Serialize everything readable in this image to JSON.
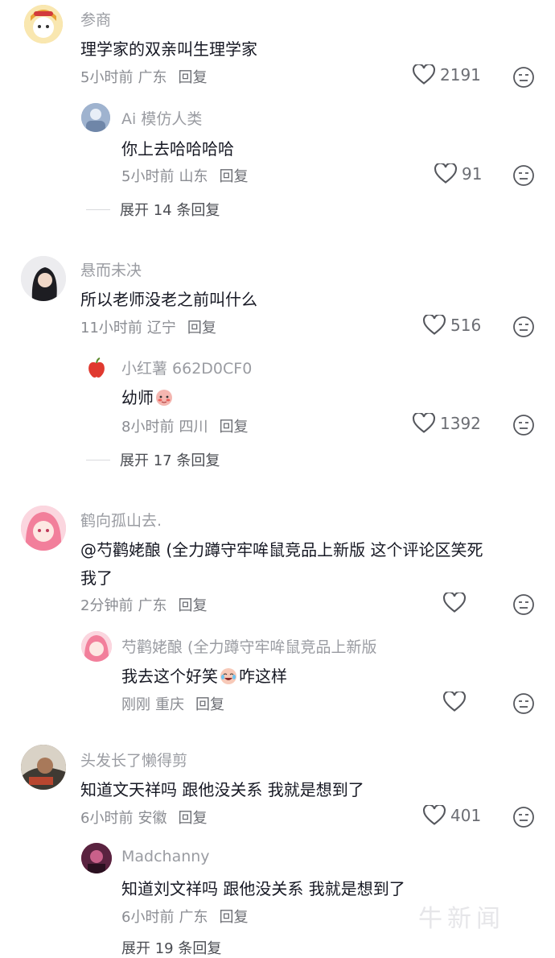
{
  "comments": [
    {
      "name": "参商",
      "text": "理学家的双亲叫生理学家",
      "time": "5小时前",
      "location": "广东",
      "reply_label": "回复",
      "likes": "2191",
      "avatar_color": "#f2b24a",
      "replies": [
        {
          "name": "Ai 模仿人类",
          "text": "你上去哈哈哈哈",
          "time": "5小时前",
          "location": "山东",
          "reply_label": "回复",
          "likes": "91",
          "avatar_color": "#8aa0c2"
        }
      ],
      "expand": "展开 14 条回复"
    },
    {
      "name": "悬而未决",
      "text": "所以老师没老之前叫什么",
      "time": "11小时前",
      "location": "辽宁",
      "reply_label": "回复",
      "likes": "516",
      "avatar_color": "#2b2b2f",
      "replies": [
        {
          "name": "小红薯 662D0CF0",
          "text": "幼师",
          "emoji": "blushing-face-emoji",
          "time": "8小时前",
          "location": "四川",
          "reply_label": "回复",
          "likes": "1392",
          "avatar_color": "#e0392f"
        }
      ],
      "expand": "展开 17 条回复"
    },
    {
      "name": "鹤向孤山去.",
      "text_line1": "@芍鹳姥酿 (全力蹲守牢哞鼠竞品上新版  这个评论区笑死",
      "text_line2": "我了",
      "time": "2分钟前",
      "location": "广东",
      "reply_label": "回复",
      "likes": "",
      "avatar_color": "#f59bb0",
      "replies": [
        {
          "name": "芍鹳姥酿 (全力蹲守牢哞鼠竞品上新版",
          "text_before": "我去这个好笑",
          "emoji": "crying-laughing-emoji",
          "text_after": "咋这样",
          "time": "刚刚",
          "location": "重庆",
          "reply_label": "回复",
          "likes": "",
          "avatar_color": "#f6a7c0"
        }
      ]
    },
    {
      "name": "头发长了懒得剪",
      "text": "知道文天祥吗  跟他没关系  我就是想到了",
      "time": "6小时前",
      "location": "安徽",
      "reply_label": "回复",
      "likes": "401",
      "avatar_color": "#6b5a4a",
      "replies": [
        {
          "name": "Madchanny",
          "text": "知道刘文祥吗  跟他没关系  我就是想到了",
          "time": "6小时前",
          "location": "广东",
          "reply_label": "回复",
          "likes": "",
          "avatar_color": "#8a2a4a"
        }
      ],
      "expand": "展开 19 条回复"
    }
  ],
  "watermark": "牛新闻"
}
